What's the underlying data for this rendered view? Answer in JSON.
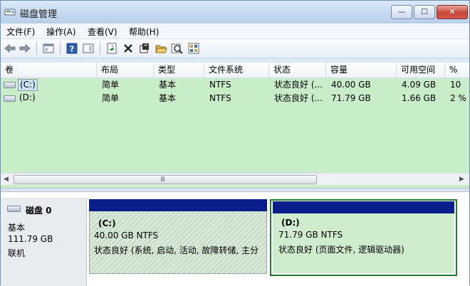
{
  "window": {
    "title": "磁盘管理",
    "controls": {
      "minimize": "—",
      "maximize": "☐",
      "close": "✕"
    }
  },
  "menu": [
    "文件(F)",
    "操作(A)",
    "查看(V)",
    "帮助(H)"
  ],
  "toolbar": {
    "icons": [
      "back-arrow-icon",
      "forward-arrow-icon",
      "console-tree-icon",
      "help-icon",
      "action-pane-icon",
      "refresh-icon",
      "delete-icon",
      "properties-icon",
      "open-folder-icon",
      "search-icon",
      "settings-icon"
    ]
  },
  "volume_list": {
    "columns": [
      "卷",
      "布局",
      "类型",
      "文件系统",
      "状态",
      "容量",
      "可用空间",
      "%"
    ],
    "rows": [
      {
        "volume": "(C:)",
        "layout": "简单",
        "type": "基本",
        "fs": "NTFS",
        "status": "状态良好 (...",
        "capacity": "40.00 GB",
        "free": "4.09 GB",
        "pct": "10",
        "selected": true
      },
      {
        "volume": "(D:)",
        "layout": "简单",
        "type": "基本",
        "fs": "NTFS",
        "status": "状态良好 (...",
        "capacity": "71.79 GB",
        "free": "1.66 GB",
        "pct": "2 %",
        "selected": false
      }
    ],
    "scroll_grip": "III"
  },
  "disk": {
    "name": "磁盘 0",
    "type": "基本",
    "size": "111.79 GB",
    "state": "联机",
    "partitions": [
      {
        "label": "(C:)",
        "size_fs": "40.00 GB NTFS",
        "status": "状态良好 (系统, 启动, 活动, 故障转储, 主分"
      },
      {
        "label": "(D:)",
        "size_fs": "71.79 GB NTFS",
        "status": "状态良好 (页面文件, 逻辑驱动器)"
      }
    ]
  },
  "colors": {
    "partition_bar": "#0a1f8c",
    "selected_frame": "#1e7d2c",
    "list_bg": "#c9ecc9"
  }
}
